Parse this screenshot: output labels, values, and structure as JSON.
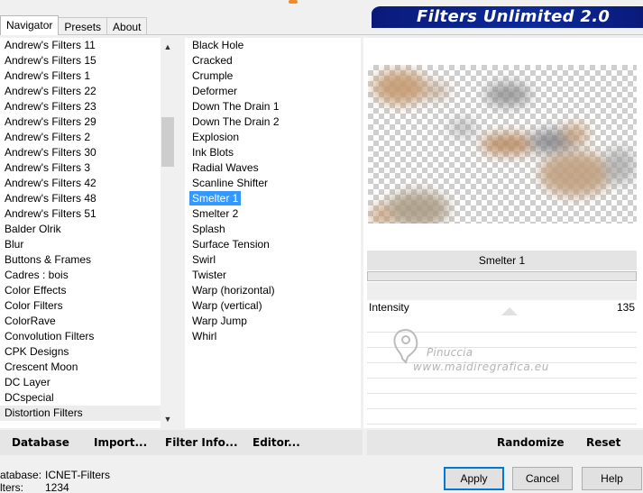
{
  "banner": {
    "accent_color": "#f08a2a",
    "brand_color": "#0c2a9a"
  },
  "tabs": [
    {
      "label": "Navigator",
      "active": true
    },
    {
      "label": "Presets",
      "active": false
    },
    {
      "label": "About",
      "active": false
    }
  ],
  "header": {
    "title": "Filters Unlimited 2.0"
  },
  "categories": [
    "Andrew's Filters 11",
    "Andrew's Filters 15",
    "Andrew's Filters 1",
    "Andrew's Filters 22",
    "Andrew's Filters 23",
    "Andrew's Filters 29",
    "Andrew's Filters 2",
    "Andrew's Filters 30",
    "Andrew's Filters 3",
    "Andrew's Filters 42",
    "Andrew's Filters 48",
    "Andrew's Filters 51",
    "Balder Olrik",
    "Blur",
    "Buttons & Frames",
    "Cadres : bois",
    "Color Effects",
    "Color Filters",
    "ColorRave",
    "Convolution Filters",
    "CPK Designs",
    "Crescent Moon",
    "DC Layer",
    "DCspecial",
    "Distortion Filters"
  ],
  "selected_category": "Distortion Filters",
  "filters": [
    "Black Hole",
    "Cracked",
    "Crumple",
    "Deformer",
    "Down The Drain 1",
    "Down The Drain 2",
    "Explosion",
    "Ink Blots",
    "Radial Waves",
    "Scanline Shifter",
    "Smelter 1",
    "Smelter 2",
    "Splash",
    "Surface Tension",
    "Swirl",
    "Twister",
    "Warp (horizontal)",
    "Warp (vertical)",
    "Warp Jump",
    "Whirl"
  ],
  "selected_filter": "Smelter 1",
  "preview": {
    "filter_name": "Smelter 1"
  },
  "parameters": [
    {
      "label": "Intensity",
      "value": "135"
    }
  ],
  "watermark": {
    "line1": "Pinuccia",
    "line2": "www.maidiregrafica.eu"
  },
  "toolbar": {
    "database": "Database",
    "import": "Import...",
    "filter_info": "Filter Info...",
    "editor": "Editor...",
    "randomize": "Randomize",
    "reset": "Reset"
  },
  "status": {
    "database_label": "atabase:",
    "database_value": "ICNET-Filters",
    "filters_label": "lters:",
    "filters_value": "1234"
  },
  "buttons": {
    "apply": "Apply",
    "cancel": "Cancel",
    "help": "Help"
  }
}
